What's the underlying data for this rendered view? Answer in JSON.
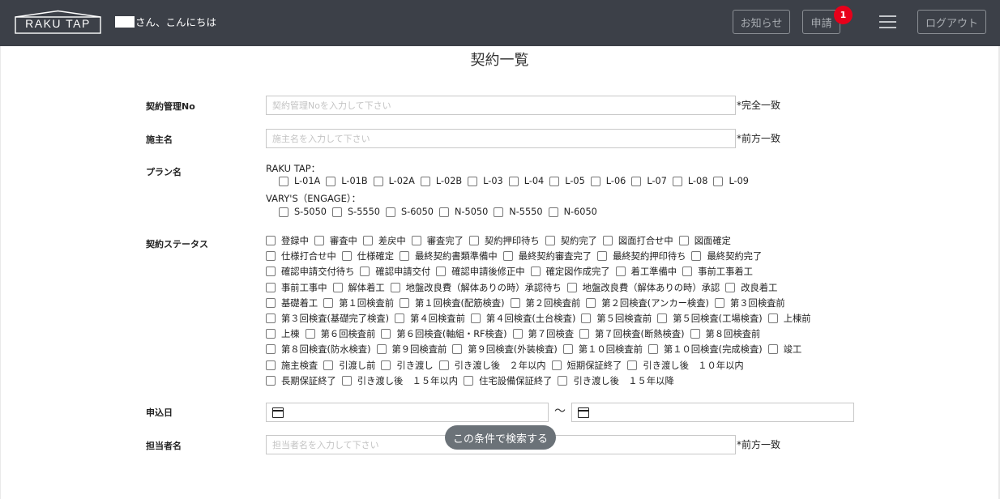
{
  "header": {
    "logo_text": "RAKU TAP",
    "greeting": "さん、こんにちは",
    "notice_label": "お知らせ",
    "apply_label": "申請",
    "apply_badge": "1",
    "logout_label": "ログアウト"
  },
  "page_title": "契約一覧",
  "fields": {
    "contract_no": {
      "label": "契約管理No",
      "placeholder": "契約管理Noを入力して下さい",
      "note": "*完全一致"
    },
    "owner": {
      "label": "施主名",
      "placeholder": "施主名を入力して下さい",
      "note": "*前方一致"
    },
    "plan": {
      "label": "プラン名",
      "group1_title": "RAKU TAP：",
      "group1_options": [
        "L-01A",
        "L-01B",
        "L-02A",
        "L-02B",
        "L-03",
        "L-04",
        "L-05",
        "L-06",
        "L-07",
        "L-08",
        "L-09"
      ],
      "group2_title": "VARY'S（ENGAGE）：",
      "group2_options": [
        "S-5050",
        "S-5550",
        "S-6050",
        "N-5050",
        "N-5550",
        "N-6050"
      ]
    },
    "status": {
      "label": "契約ステータス",
      "rows": [
        [
          "登録中",
          "審査中",
          "差戻中",
          "審査完了",
          "契約押印待ち",
          "契約完了",
          "図面打合せ中",
          "図面確定"
        ],
        [
          "仕様打合せ中",
          "仕様確定",
          "最終契約書類準備中",
          "最終契約審査完了",
          "最終契約押印待ち",
          "最終契約完了"
        ],
        [
          "確認申請交付待ち",
          "確認申請交付",
          "確認申請後修正中",
          "確定図作成完了",
          "着工準備中",
          "事前工事着工"
        ],
        [
          "事前工事中",
          "解体着工",
          "地盤改良費（解体ありの時）承認待ち",
          "地盤改良費（解体ありの時）承認",
          "改良着工"
        ],
        [
          "基礎着工",
          "第１回検査前",
          "第１回検査(配筋検査)",
          "第２回検査前",
          "第２回検査(アンカー検査)",
          "第３回検査前"
        ],
        [
          "第３回検査(基礎完了検査)",
          "第４回検査前",
          "第４回検査(土台検査)",
          "第５回検査前",
          "第５回検査(工場検査)",
          "上棟前"
        ],
        [
          "上棟",
          "第６回検査前",
          "第６回検査(軸組・RF検査)",
          "第７回検査",
          "第７回検査(断熱検査)",
          "第８回検査前"
        ],
        [
          "第８回検査(防水検査)",
          "第９回検査前",
          "第９回検査(外装検査)",
          "第１０回検査前",
          "第１０回検査(完成検査)",
          "竣工"
        ],
        [
          "施主検査",
          "引渡し前",
          "引き渡し",
          "引き渡し後　２年以内",
          "短期保証終了",
          "引き渡し後　１０年以内"
        ],
        [
          "長期保証終了",
          "引き渡し後　１５年以内",
          "住宅設備保証終了",
          "引き渡し後　１５年以降"
        ]
      ]
    },
    "apply_date": {
      "label": "申込日",
      "separator": "～"
    },
    "staff": {
      "label": "担当者名",
      "placeholder": "担当者名を入力して下さい",
      "note": "*前方一致"
    }
  },
  "search_button_label": "この条件で検索する",
  "colors": {
    "header_bg": "#3c4048",
    "badge": "#e8001a",
    "search_button": "#6b7278"
  }
}
